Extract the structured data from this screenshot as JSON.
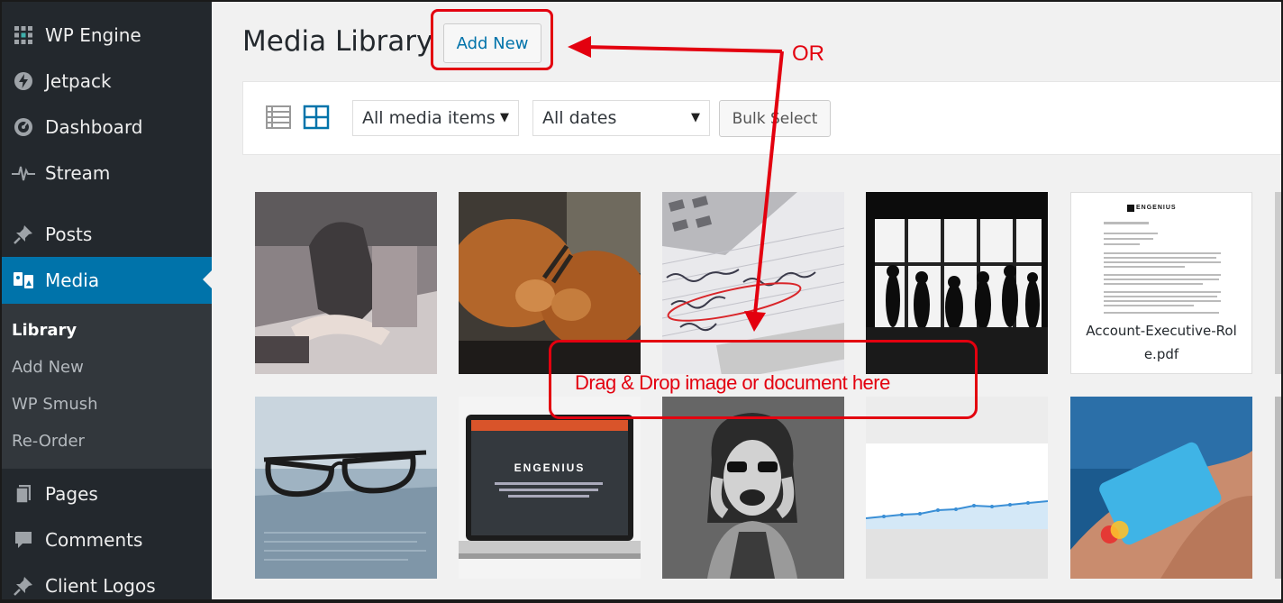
{
  "sidebar": {
    "top_items": [
      {
        "label": "WP Engine",
        "icon": "grid-icon"
      },
      {
        "label": "Jetpack",
        "icon": "bolt-icon"
      },
      {
        "label": "Dashboard",
        "icon": "gauge-icon"
      },
      {
        "label": "Stream",
        "icon": "pulse-icon"
      }
    ],
    "posts": {
      "label": "Posts",
      "icon": "pin-icon"
    },
    "media": {
      "label": "Media",
      "icon": "media-icon"
    },
    "submenu": [
      "Library",
      "Add New",
      "WP Smush",
      "Re-Order"
    ],
    "bottom_items": [
      {
        "label": "Pages",
        "icon": "page-icon"
      },
      {
        "label": "Comments",
        "icon": "comment-icon"
      },
      {
        "label": "Client Logos",
        "icon": "pin-icon"
      }
    ]
  },
  "header": {
    "title": "Media Library",
    "add_new_label": "Add New"
  },
  "toolbar": {
    "filter_type": "All media items",
    "filter_date": "All dates",
    "bulk_label": "Bulk Select"
  },
  "media_items": [
    {
      "kind": "image",
      "subject": "hands-cutting-workshop"
    },
    {
      "kind": "image",
      "subject": "goats-fighting"
    },
    {
      "kind": "image",
      "subject": "calculator-handwriting"
    },
    {
      "kind": "image",
      "subject": "silhouettes-window"
    },
    {
      "kind": "document",
      "filename": "Account-Executive-Role.pdf",
      "logo_text": "ENGENIUS"
    },
    {
      "kind": "image",
      "subject": "eyeglasses-on-paper"
    },
    {
      "kind": "image",
      "subject": "laptop-engenius",
      "screen_text": "ENGENIUS"
    },
    {
      "kind": "image",
      "subject": "woman-laughing"
    },
    {
      "kind": "image",
      "subject": "analytics-chart"
    },
    {
      "kind": "image",
      "subject": "credit-card-hand"
    }
  ],
  "annotations": {
    "or_label": "OR",
    "drop_label": "Drag & Drop image or document here",
    "color": "#e3000f"
  },
  "colors": {
    "sidebar": "#23282d",
    "submenu": "#32373c",
    "accent": "#0073aa",
    "background": "#f1f1f1"
  }
}
